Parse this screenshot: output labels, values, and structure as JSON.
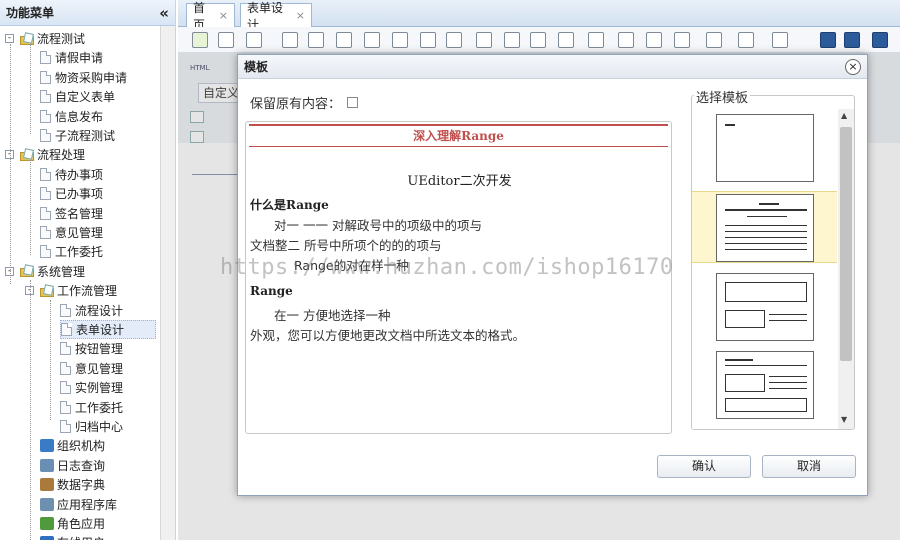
{
  "sidebar": {
    "title": "功能菜单",
    "collapse_glyph": "«",
    "items": [
      {
        "label": "流程测试",
        "toggle": "-"
      },
      {
        "label": "请假申请"
      },
      {
        "label": "物资采购申请"
      },
      {
        "label": "自定义表单"
      },
      {
        "label": "信息发布"
      },
      {
        "label": "子流程测试"
      },
      {
        "label": "流程处理",
        "toggle": "-"
      },
      {
        "label": "待办事项"
      },
      {
        "label": "已办事项"
      },
      {
        "label": "签名管理"
      },
      {
        "label": "意见管理"
      },
      {
        "label": "工作委托"
      },
      {
        "label": "系统管理",
        "toggle": "-"
      },
      {
        "label": "工作流管理",
        "toggle": "-"
      },
      {
        "label": "流程设计"
      },
      {
        "label": "表单设计"
      },
      {
        "label": "按钮管理"
      },
      {
        "label": "意见管理"
      },
      {
        "label": "实例管理"
      },
      {
        "label": "工作委托"
      },
      {
        "label": "归档中心"
      },
      {
        "label": "组织机构"
      },
      {
        "label": "日志查询"
      },
      {
        "label": "数据字典"
      },
      {
        "label": "应用程序库"
      },
      {
        "label": "角色应用"
      },
      {
        "label": "在线用户"
      }
    ]
  },
  "tabs": [
    {
      "label": "首页",
      "close": "×"
    },
    {
      "label": "表单设计",
      "close": "×"
    }
  ],
  "editor": {
    "html_label": "HTML",
    "custom_label": "自定义"
  },
  "modal": {
    "title": "模板",
    "close": "×",
    "keep_label": "保留原有内容：",
    "preview": {
      "title": "深入理解Range",
      "subtitle": "UEditor二次开发",
      "heading1": "什么是Range",
      "p1": "对一    一一        对解政号中的项级中的项与",
      "p2": "文档整二 所号中所项个的的的项与",
      "p3": "Range的对在样一种",
      "heading2": "Range",
      "p4": "在一                    方便地选择一种",
      "p5": "外观，您可以方便地更改文档中所选文本的格式。"
    },
    "template_label": "选择模板",
    "confirm": "确认",
    "cancel": "取消"
  },
  "watermark": "https://www.huzhan.com/ishop16170",
  "colors": {
    "accent": "#c0504d",
    "selection": "#fdf6cf"
  }
}
